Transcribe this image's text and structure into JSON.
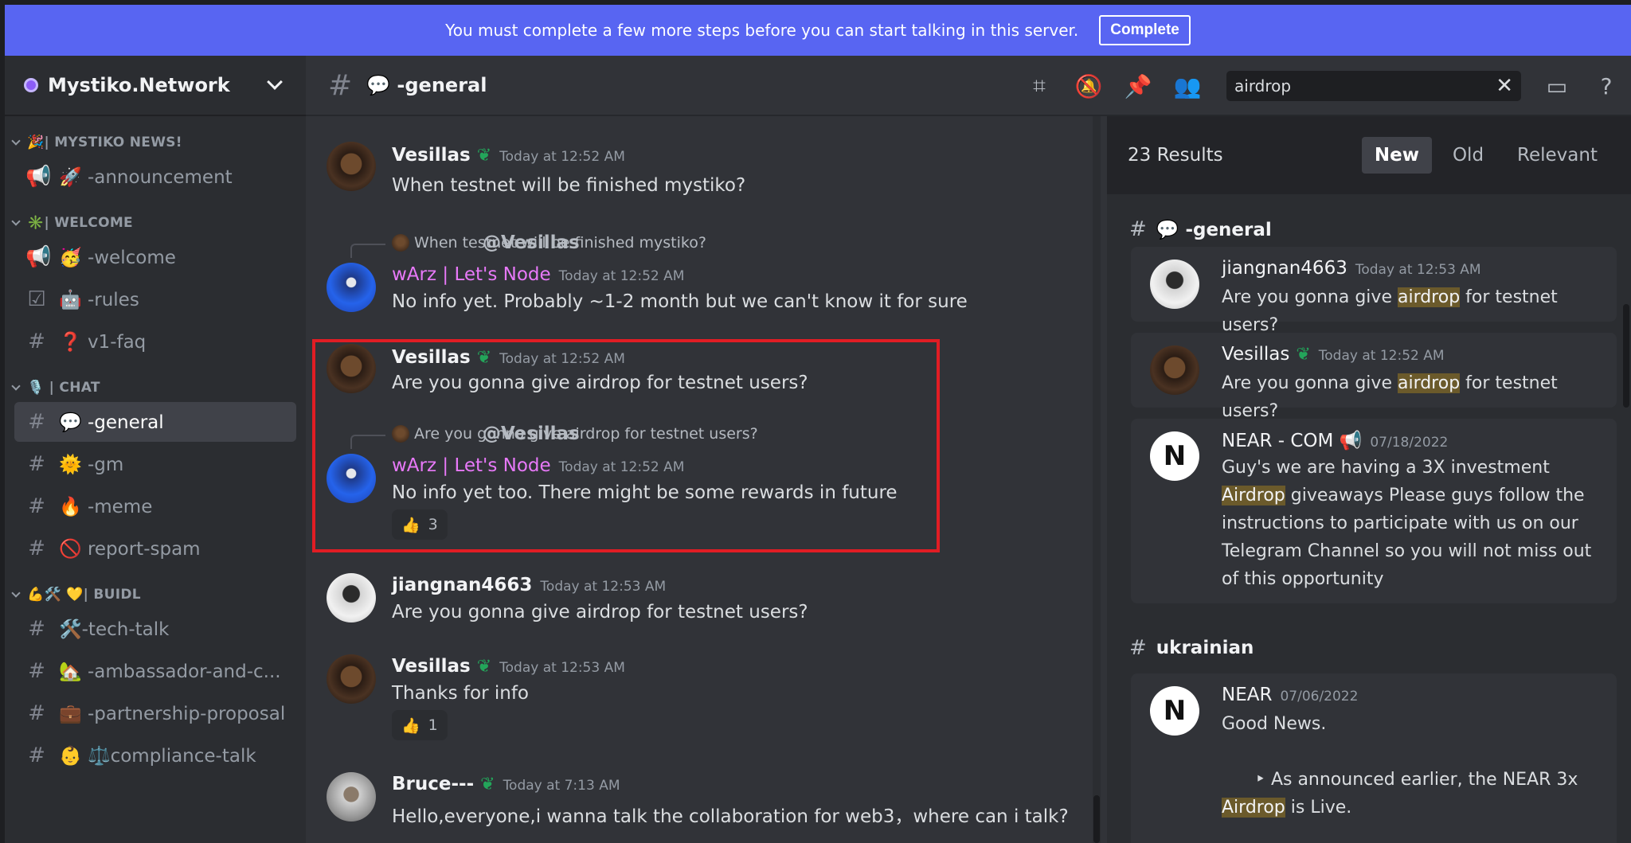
{
  "notice": {
    "text": "You must complete a few more steps before you can start talking in this server.",
    "button": "Complete"
  },
  "server": {
    "name": "Mystiko.Network"
  },
  "sidebar": {
    "categories": [
      {
        "label": "🎉| MYSTIKO NEWS!"
      },
      {
        "label": "✳️| WELCOME"
      },
      {
        "label": "🎙️ | CHAT"
      },
      {
        "label": "💪🛠️ 💛| BUIDL"
      }
    ],
    "channels": [
      {
        "label": "🚀 -announcement",
        "icon": "megaphone-icon"
      },
      {
        "label": "🥳 -welcome",
        "icon": "megaphone-icon"
      },
      {
        "label": "🤖 -rules",
        "icon": "checkbox-icon"
      },
      {
        "label": "❓ v1-faq",
        "icon": "hash-icon"
      },
      {
        "label": "💬 -general",
        "icon": "hash-icon"
      },
      {
        "label": "🌞 -gm",
        "icon": "hash-icon"
      },
      {
        "label": "🔥 -meme",
        "icon": "hash-icon"
      },
      {
        "label": "🚫 report-spam",
        "icon": "hash-icon"
      },
      {
        "label": "🛠️-tech-talk",
        "icon": "hash-icon"
      },
      {
        "label": "🏡 -ambassador-and-c...",
        "icon": "hash-icon"
      },
      {
        "label": "💼 -partnership-proposal",
        "icon": "hash-icon"
      },
      {
        "label": "👶 ⚖️compliance-talk",
        "icon": "hash-icon"
      }
    ]
  },
  "chat": {
    "title": "💬 -general",
    "search_value": "airdrop",
    "messages": [
      {
        "author": "Vesillas",
        "time": "Today at 12:52 AM",
        "text": "When testnet will be finished mystiko?"
      },
      {
        "reply_to": "@Vesillas",
        "reply_text": "When testnet will be finished mystiko?",
        "author": "wArz | Let's Node",
        "time": "Today at 12:52 AM",
        "text": "No info yet. Probably ~1-2 month but we can't know it for sure"
      },
      {
        "author": "Vesillas",
        "time": "Today at 12:52 AM",
        "text": "Are you gonna give airdrop for testnet users?"
      },
      {
        "reply_to": "@Vesillas",
        "reply_text": "Are you gonna give airdrop for testnet users?",
        "author": "wArz | Let's Node",
        "time": "Today at 12:52 AM",
        "text": "No info yet too. There might be some rewards in future",
        "reaction": "3"
      },
      {
        "author": "jiangnan4663",
        "time": "Today at 12:53 AM",
        "text": "Are you gonna give airdrop for testnet users?"
      },
      {
        "author": "Vesillas",
        "time": "Today at 12:53 AM",
        "text": "Thanks for info",
        "reaction": "1"
      },
      {
        "author": "Bruce---",
        "time": "Today at 7:13 AM",
        "text": "Hello,everyone,i wanna talk the collaboration for web3，where can i talk?"
      }
    ]
  },
  "results": {
    "count": "23 Results",
    "sort": [
      "New",
      "Old",
      "Relevant"
    ],
    "groups": [
      {
        "channel": "💬 -general"
      },
      {
        "channel": "ukrainian"
      }
    ],
    "cards": [
      {
        "author": "jiangnan4663",
        "time": "Today at 12:53 AM",
        "pre": "Are you gonna give ",
        "hl": "airdrop",
        "post": " for testnet users?"
      },
      {
        "author": "Vesillas",
        "time": "Today at 12:52 AM",
        "pre": "Are you gonna give ",
        "hl": "airdrop",
        "post": " for testnet users?"
      },
      {
        "author": "NEAR - COM 📢",
        "time": "07/18/2022",
        "pre": "Guy's we are having a 3X investment ",
        "hl": "Airdrop",
        "post": " giveaways Please guys follow the instructions to participate with us on our Telegram Channel so you will not miss out of this opportunity"
      },
      {
        "author": "NEAR",
        "time": "07/06/2022",
        "line1": "Good News.",
        "bullet": "‣ As announced earlier, the NEAR 3x",
        "hl": "Airdrop",
        "post": " is Live."
      }
    ]
  },
  "colors": {
    "accent": "#5865f2",
    "highlight": "#e11d24",
    "purple_name": "#e879f9",
    "green": "#23a55a"
  }
}
